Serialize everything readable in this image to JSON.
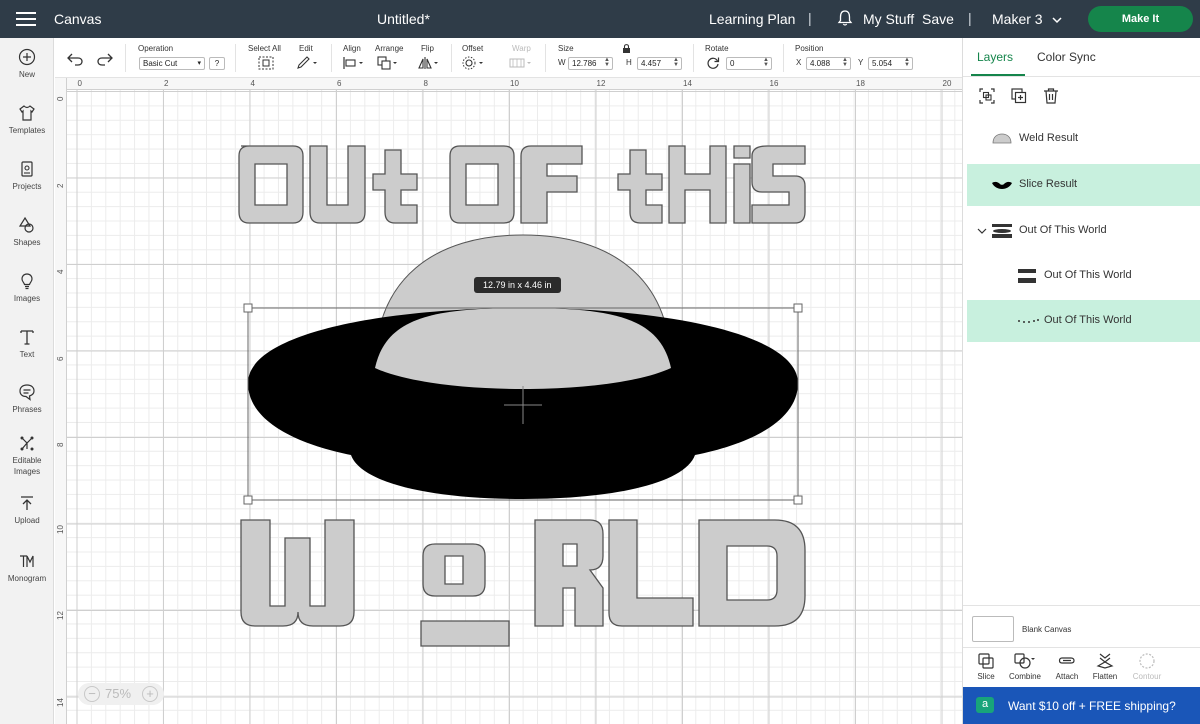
{
  "header": {
    "app_title": "Canvas",
    "doc_title": "Untitled*",
    "learning_plan": "Learning Plan",
    "sep": "|",
    "my_stuff": "My Stuff",
    "save": "Save",
    "machine": "Maker 3",
    "make_it": "Make It"
  },
  "sidebar": {
    "items": [
      {
        "label": "New",
        "icon": "plus-circle-icon"
      },
      {
        "label": "Templates",
        "icon": "shirt-icon"
      },
      {
        "label": "Projects",
        "icon": "projects-icon"
      },
      {
        "label": "Shapes",
        "icon": "shapes-icon"
      },
      {
        "label": "Images",
        "icon": "bulb-icon"
      },
      {
        "label": "Text",
        "icon": "text-icon"
      },
      {
        "label": "Phrases",
        "icon": "speech-bubble-icon"
      },
      {
        "label": "Editable Images",
        "icon": "editable-images-icon"
      },
      {
        "label": "Upload",
        "icon": "upload-icon"
      },
      {
        "label": "Monogram",
        "icon": "monogram-icon"
      }
    ]
  },
  "toolbar": {
    "operation_label": "Operation",
    "operation_value": "Basic Cut",
    "help": "?",
    "select_all_label": "Select All",
    "edit_label": "Edit",
    "align_label": "Align",
    "arrange_label": "Arrange",
    "flip_label": "Flip",
    "offset_label": "Offset",
    "warp_label": "Warp",
    "size_label": "Size",
    "w_label": "W",
    "w_value": "12.786",
    "h_label": "H",
    "h_value": "4.457",
    "rotate_label": "Rotate",
    "rotate_value": "0",
    "position_label": "Position",
    "x_label": "X",
    "x_value": "4.088",
    "y_label": "Y",
    "y_value": "5.054"
  },
  "canvas": {
    "ruler_top": [
      "0",
      "2",
      "4",
      "6",
      "8",
      "10",
      "12",
      "14",
      "16",
      "18",
      "20"
    ],
    "ruler_left": [
      "0",
      "2",
      "4",
      "6",
      "8",
      "10",
      "12",
      "14"
    ],
    "text_top": "OUT OF THIS",
    "text_bottom": "WORLD",
    "dims_badge": "12.79  in x 4.46  in",
    "zoom_level": "75%"
  },
  "right_panel": {
    "tabs": [
      {
        "label": "Layers",
        "active": true
      },
      {
        "label": "Color Sync",
        "active": false
      }
    ],
    "layers": [
      {
        "name": "Weld Result",
        "selected": false,
        "indent": 0
      },
      {
        "name": "Slice Result",
        "selected": true,
        "indent": 0
      },
      {
        "name": "Out Of This World",
        "selected": false,
        "indent": 0,
        "group": true
      },
      {
        "name": "Out Of This World",
        "selected": false,
        "indent": 1
      },
      {
        "name": "Out Of This World",
        "selected": true,
        "indent": 1
      }
    ],
    "blank_canvas": "Blank Canvas",
    "tools": [
      {
        "label": "Slice",
        "enabled": true
      },
      {
        "label": "Combine",
        "enabled": true
      },
      {
        "label": "Attach",
        "enabled": true
      },
      {
        "label": "Flatten",
        "enabled": true
      },
      {
        "label": "Contour",
        "enabled": false
      }
    ],
    "promo_badge": "a",
    "promo_text": "Want $10 off + FREE shipping?"
  },
  "colors": {
    "header_bg": "#2f3c48",
    "accent_green": "#15854b",
    "layer_selected": "#c8f0de",
    "shape_gray": "#cccccc",
    "promo_blue": "#1a56b8"
  }
}
